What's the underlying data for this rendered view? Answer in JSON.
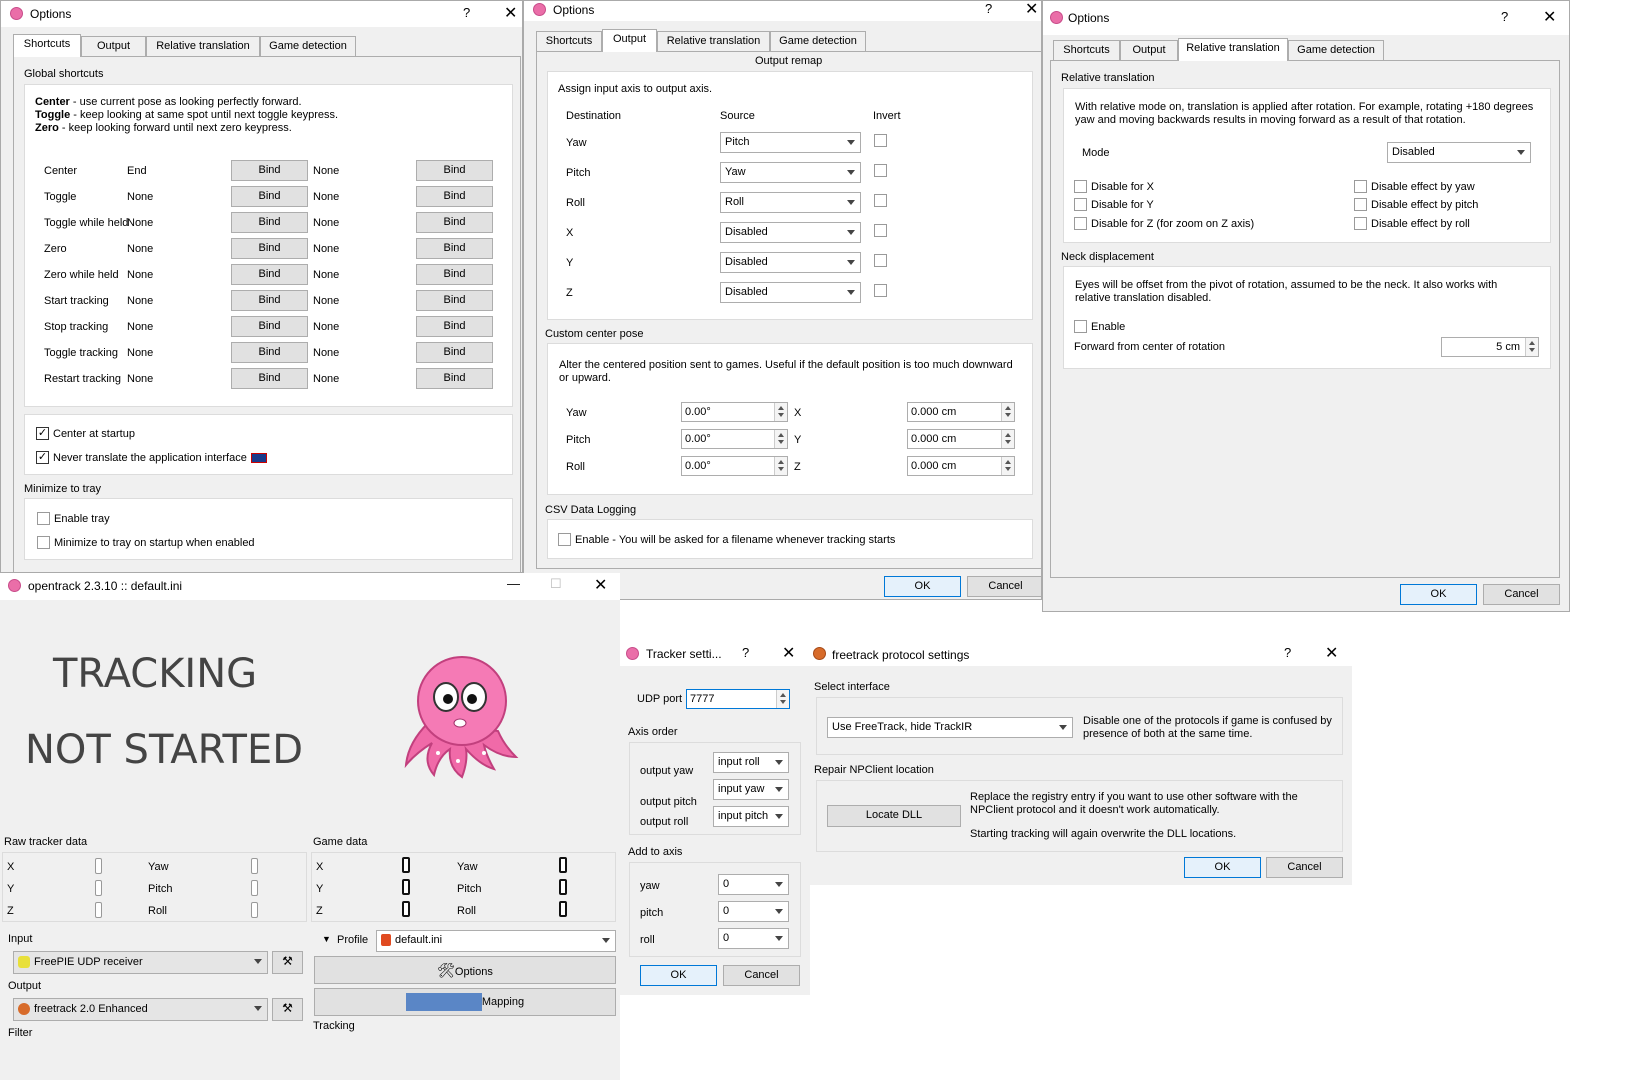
{
  "opt1": {
    "title": "Options",
    "help": "?",
    "close": "✕",
    "tabs": [
      "Shortcuts",
      "Output",
      "Relative translation",
      "Game detection"
    ],
    "global_label": "Global shortcuts",
    "help_lines": [
      {
        "bold": "Center",
        "rest": " - use current pose as looking perfectly forward."
      },
      {
        "bold": "Toggle",
        "rest": " - keep looking at same spot until next toggle keypress."
      },
      {
        "bold": "Zero",
        "rest": " - keep looking forward until next zero keypress."
      }
    ],
    "rows": [
      {
        "name": "Center",
        "key1": "End",
        "key2": "None"
      },
      {
        "name": "Toggle",
        "key1": "None",
        "key2": "None"
      },
      {
        "name": "Toggle while held",
        "key1": "None",
        "key2": "None"
      },
      {
        "name": "Zero",
        "key1": "None",
        "key2": "None"
      },
      {
        "name": "Zero while held",
        "key1": "None",
        "key2": "None"
      },
      {
        "name": "Start tracking",
        "key1": "None",
        "key2": "None"
      },
      {
        "name": "Stop tracking",
        "key1": "None",
        "key2": "None"
      },
      {
        "name": "Toggle tracking",
        "key1": "None",
        "key2": "None"
      },
      {
        "name": "Restart tracking",
        "key1": "None",
        "key2": "None"
      }
    ],
    "bind_label": "Bind",
    "center_startup": "Center at startup",
    "never_translate": "Never translate the application interface",
    "minimize_label": "Minimize to tray",
    "enable_tray": "Enable tray",
    "minimize_startup": "Minimize to tray on startup when enabled"
  },
  "opt2": {
    "title": "Options",
    "help": "?",
    "close": "✕",
    "tabs": [
      "Shortcuts",
      "Output",
      "Relative translation",
      "Game detection"
    ],
    "remap_label": "Output remap",
    "assign_text": "Assign input axis to output axis.",
    "col_dest": "Destination",
    "col_src": "Source",
    "col_inv": "Invert",
    "remap": [
      {
        "dest": "Yaw",
        "src": "Pitch"
      },
      {
        "dest": "Pitch",
        "src": "Yaw"
      },
      {
        "dest": "Roll",
        "src": "Roll"
      },
      {
        "dest": "X",
        "src": "Disabled"
      },
      {
        "dest": "Y",
        "src": "Disabled"
      },
      {
        "dest": "Z",
        "src": "Disabled"
      }
    ],
    "center_label": "Custom center pose",
    "center_text": "Alter the centered position sent to games. Useful if the default position is too much downward or upward.",
    "pose": [
      {
        "a": "Yaw",
        "av": "0.00°",
        "b": "X",
        "bv": "0.000 cm"
      },
      {
        "a": "Pitch",
        "av": "0.00°",
        "b": "Y",
        "bv": "0.000 cm"
      },
      {
        "a": "Roll",
        "av": "0.00°",
        "b": "Z",
        "bv": "0.000 cm"
      }
    ],
    "csv_label": "CSV Data Logging",
    "csv_text": "Enable - You will be asked for a filename whenever tracking starts",
    "ok": "OK",
    "cancel": "Cancel"
  },
  "opt3": {
    "title": "Options",
    "help": "?",
    "close": "✕",
    "tabs": [
      "Shortcuts",
      "Output",
      "Relative translation",
      "Game detection"
    ],
    "rel_label": "Relative translation",
    "rel_text": "With relative mode on, translation is applied after rotation. For example, rotating +180 degrees yaw and moving backwards results in moving forward as a result of that rotation.",
    "mode_label": "Mode",
    "mode_value": "Disabled",
    "dis_x": "Disable for X",
    "dis_y": "Disable for Y",
    "dis_z": "Disable for Z (for zoom on Z axis)",
    "eff_yaw": "Disable effect by yaw",
    "eff_pitch": "Disable effect by pitch",
    "eff_roll": "Disable effect by roll",
    "neck_label": "Neck displacement",
    "neck_text": "Eyes will be offset from the pivot of rotation, assumed to be the neck. It also works with relative translation disabled.",
    "enable": "Enable",
    "forward_label": "Forward from center of rotation",
    "forward_value": "5 cm",
    "ok": "OK",
    "cancel": "Cancel"
  },
  "main": {
    "title": "opentrack 2.3.10 :: default.ini",
    "minimize": "—",
    "maximize": "☐",
    "close": "✕",
    "status1": "TRACKING",
    "status2": "NOT STARTED",
    "raw_label": "Raw tracker data",
    "game_label": "Game data",
    "axes_left": [
      "X",
      "Y",
      "Z"
    ],
    "axes_right": [
      "Yaw",
      "Pitch",
      "Roll"
    ],
    "input_label": "Input",
    "input_value": "FreePIE UDP receiver",
    "output_label": "Output",
    "output_value": "freetrack 2.0 Enhanced",
    "filter_label": "Filter",
    "profile_label": "Profile",
    "profile_value": "default.ini",
    "options_btn": "Options",
    "mapping_btn": "Mapping",
    "tracking_label": "Tracking"
  },
  "tracker": {
    "title": "Tracker setti...",
    "help": "?",
    "close": "✕",
    "udp_label": "UDP port",
    "udp_value": "7777",
    "axis_order_label": "Axis order",
    "order": [
      {
        "label": "output yaw",
        "value": "input roll"
      },
      {
        "label": "output pitch",
        "value": "input yaw"
      },
      {
        "label": "output roll",
        "value": "input pitch"
      }
    ],
    "add_label": "Add to axis",
    "add": [
      {
        "label": "yaw",
        "value": "0"
      },
      {
        "label": "pitch",
        "value": "0"
      },
      {
        "label": "roll",
        "value": "0"
      }
    ],
    "ok": "OK",
    "cancel": "Cancel"
  },
  "freetrack": {
    "title": "freetrack protocol settings",
    "help": "?",
    "close": "✕",
    "iface_label": "Select interface",
    "iface_value": "Use FreeTrack, hide TrackIR",
    "iface_text": "Disable one of the protocols if game is confused by presence of both at the same time.",
    "repair_label": "Repair NPClient location",
    "locate_btn": "Locate DLL",
    "repair_text1": "Replace the registry entry if you want to use other software with the NPClient protocol and it doesn't work automatically.",
    "repair_text2": "Starting tracking will again overwrite the DLL locations.",
    "ok": "OK",
    "cancel": "Cancel"
  },
  "colors": {
    "accent": "#0078d7",
    "octopus": "#ea6ea8",
    "window_bg": "#f0f0f0"
  }
}
